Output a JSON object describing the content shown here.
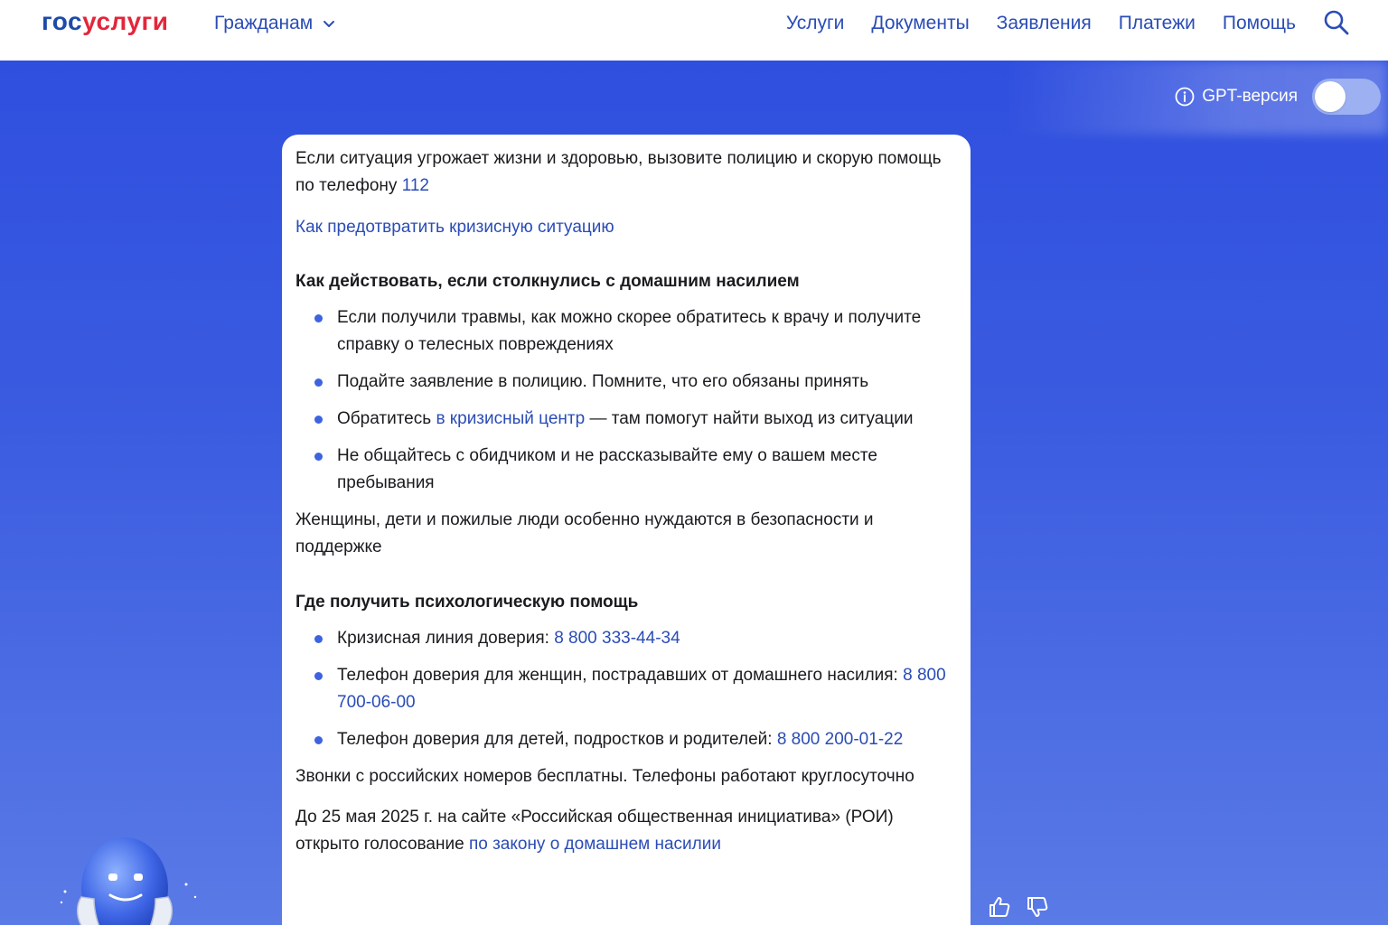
{
  "header": {
    "logo_part1": "гос",
    "logo_part2": "услуги",
    "audience": "Гражданам",
    "nav": [
      "Услуги",
      "Документы",
      "Заявления",
      "Платежи",
      "Помощь"
    ]
  },
  "gpt": {
    "label": "GPT-версия"
  },
  "card": {
    "intro_text": "Если ситуация угрожает жизни и здоровью, вызовите полицию и скорую помощь по телефону ",
    "intro_phone": "112",
    "prevent_link": "Как предотвратить кризисную ситуацию",
    "section1_title": "Как действовать, если столкнулись с домашним насилием",
    "section1_items": [
      "Если получили травмы, как можно скорее обратитесь к врачу и получите справку о телесных повреждениях",
      "Подайте заявление в полицию. Помните, что его обязаны принять",
      "Не общайтесь с обидчиком и не рассказывайте ему о вашем месте пребывания"
    ],
    "crisis_item": {
      "before": "Обратитесь ",
      "link": "в кризисный центр",
      "after": " — там помогут найти выход из ситуации"
    },
    "vulnerable_note": "Женщины, дети и пожилые люди особенно нуждаются в безопасности и поддержке",
    "section2_title": "Где получить психологическую помощь",
    "hotlines": [
      {
        "label": "Кризисная линия доверия: ",
        "phone": "8 800 333-44-34"
      },
      {
        "label": "Телефон доверия для женщин, пострадавших от домашнего насилия: ",
        "phone": "8 800 700-06-00"
      },
      {
        "label": "Телефон доверия для детей, подростков и родителей: ",
        "phone": "8 800 200-01-22"
      }
    ],
    "free_calls": "Звонки с российских номеров бесплатны. Телефоны работают круглосуточно",
    "vote_text": "До 25 мая 2025 г. на сайте «Российская общественная инициатива» (РОИ) открыто голосование ",
    "vote_link": "по закону о домашнем насилии"
  },
  "colors": {
    "brand_blue": "#1e4aa8",
    "brand_red": "#e3263b",
    "link": "#2a4cb6",
    "background": "#3a5be0"
  },
  "icons": [
    "chevron-down-icon",
    "search-icon",
    "info-icon",
    "thumbs-up-icon",
    "thumbs-down-icon"
  ]
}
